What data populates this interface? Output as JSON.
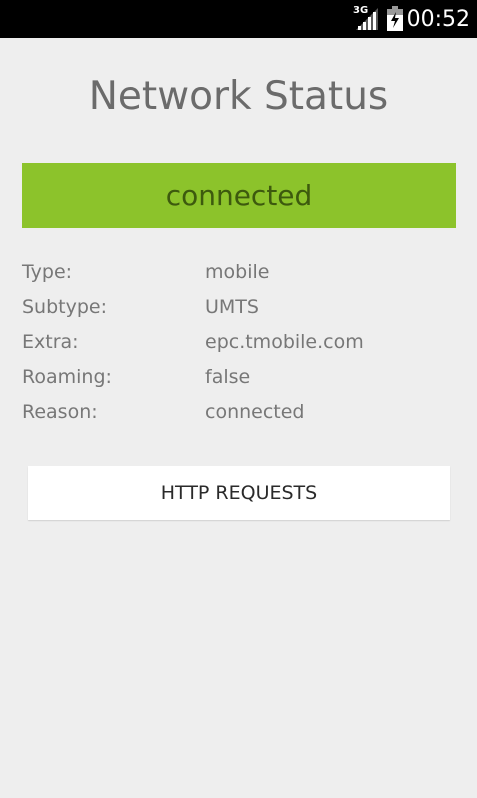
{
  "status_bar": {
    "network_type": "3G",
    "signal_icon": "signal-icon",
    "battery_icon": "battery-charging-icon",
    "time": "00:52"
  },
  "page": {
    "title": "Network Status"
  },
  "status": {
    "state": "connected",
    "color": "#8cc32b"
  },
  "details": [
    {
      "label": "Type:",
      "value": "mobile"
    },
    {
      "label": "Subtype:",
      "value": "UMTS"
    },
    {
      "label": "Extra:",
      "value": "epc.tmobile.com"
    },
    {
      "label": "Roaming:",
      "value": "false"
    },
    {
      "label": "Reason:",
      "value": "connected"
    }
  ],
  "actions": {
    "http_requests_label": "HTTP REQUESTS"
  }
}
